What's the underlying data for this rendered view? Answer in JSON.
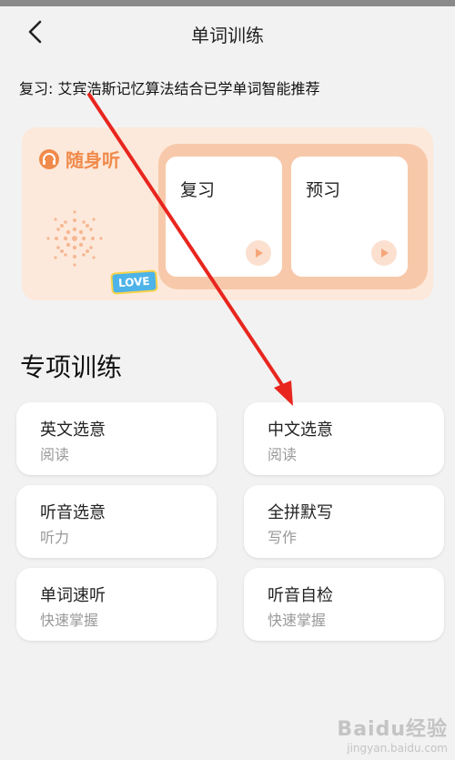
{
  "header": {
    "title": "单词训练"
  },
  "hint": "复习: 艾宾浩斯记忆算法结合已学单词智能推荐",
  "banner": {
    "logo_text": "随身听",
    "love_text": "LOVE",
    "cards": [
      {
        "label": "复习"
      },
      {
        "label": "预习"
      }
    ]
  },
  "section": {
    "title": "专项训练"
  },
  "training": [
    {
      "title": "英文选意",
      "subtitle": "阅读"
    },
    {
      "title": "中文选意",
      "subtitle": "阅读"
    },
    {
      "title": "听音选意",
      "subtitle": "听力"
    },
    {
      "title": "全拼默写",
      "subtitle": "写作"
    },
    {
      "title": "单词速听",
      "subtitle": "快速掌握"
    },
    {
      "title": "听音自检",
      "subtitle": "快速掌握"
    }
  ],
  "watermark": {
    "brand": "Baidu经验",
    "url": "jingyan.baidu.com"
  },
  "colors": {
    "accent": "#f08a4b",
    "arrow": "#e8261e",
    "banner_bg": "#fde9db"
  }
}
